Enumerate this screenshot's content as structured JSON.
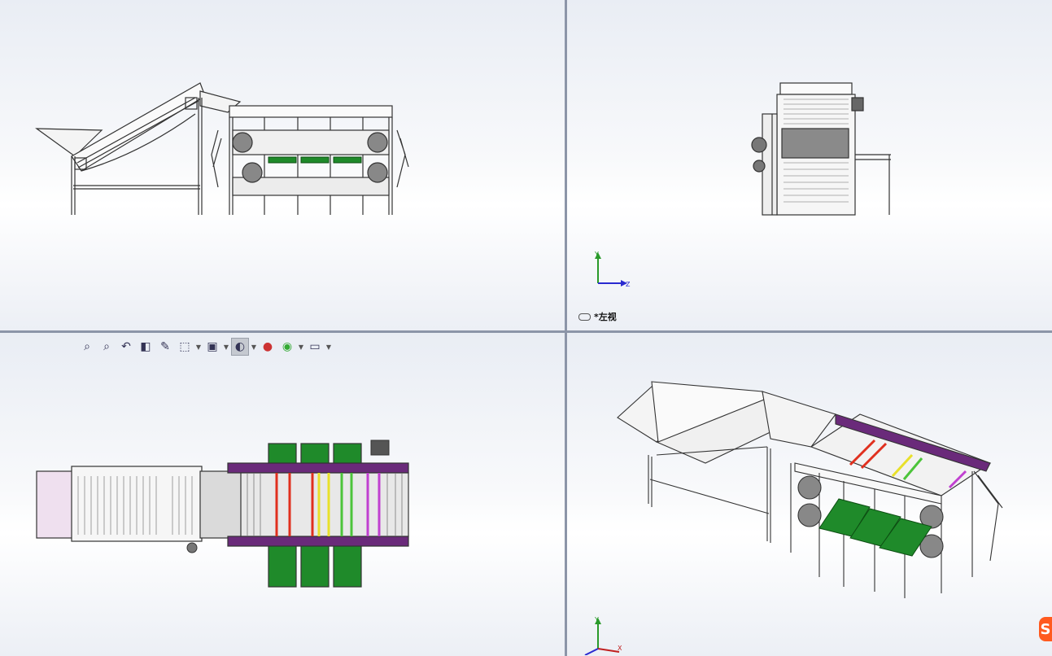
{
  "viewports": {
    "front": {
      "name": ""
    },
    "left": {
      "name": "*左视"
    },
    "top": {
      "name": ""
    },
    "iso": {
      "name": ""
    }
  },
  "triad_labels": {
    "y": "Y",
    "z": "Z",
    "x": "X"
  },
  "toolbar": {
    "items": [
      "zoom-to-fit-icon",
      "zoom-area-icon",
      "previous-view-icon",
      "section-view-icon",
      "dynamic-annotation-icon",
      "view-orientation-icon",
      "display-style-icon",
      "hide-show-icon",
      "edit-appearance-icon",
      "apply-scene-icon",
      "view-settings-icon"
    ]
  },
  "colors": {
    "belt_green": "#1f8a2a",
    "belt_purple": "#6a2a7a",
    "roller_red": "#e0301e",
    "roller_yellow": "#e8e02a",
    "roller_green": "#4cc43a",
    "roller_magenta": "#c040d0",
    "hopper_pink": "#efe0ef",
    "accent_orange": "#ff5a1f"
  }
}
